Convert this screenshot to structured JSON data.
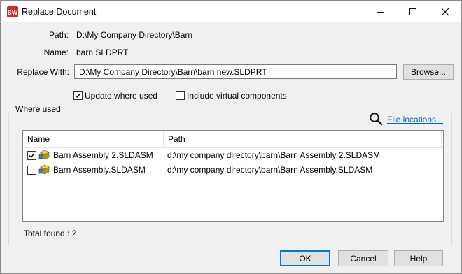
{
  "window": {
    "title": "Replace Document"
  },
  "path": {
    "label": "Path:",
    "value": "D:\\My Company Directory\\Barn"
  },
  "name": {
    "label": "Name:",
    "value": "barn.SLDPRT"
  },
  "replace_with": {
    "label": "Replace With:",
    "value": "D:\\My Company Directory\\Barn\\barn new.SLDPRT",
    "browse_label": "Browse..."
  },
  "options": {
    "update_where_used": {
      "label": "Update where used",
      "checked": true
    },
    "include_virtual": {
      "label": "Include virtual components",
      "checked": false
    }
  },
  "where_used": {
    "title": "Where used",
    "file_locations_label": "File locations...",
    "columns": [
      "Name",
      "Path"
    ],
    "rows": [
      {
        "checked": true,
        "name": "Barn Assembly 2.SLDASM",
        "path": "d:\\my company directory\\barn\\Barn Assembly 2.SLDASM"
      },
      {
        "checked": false,
        "name": "Barn Assembly.SLDASM",
        "path": "d:\\my company directory\\barn\\Barn Assembly.SLDASM"
      }
    ],
    "total_found": "Total found : 2"
  },
  "buttons": {
    "ok": "OK",
    "cancel": "Cancel",
    "help": "Help"
  },
  "icons": {
    "app": "solidworks-app-icon",
    "minimize": "minimize-icon",
    "maximize": "maximize-icon",
    "close": "close-icon",
    "search": "search-icon",
    "assembly": "assembly-icon"
  },
  "colors": {
    "accent": "#0078d7",
    "link": "#0066cc",
    "app_icon": "#d52b1e"
  }
}
